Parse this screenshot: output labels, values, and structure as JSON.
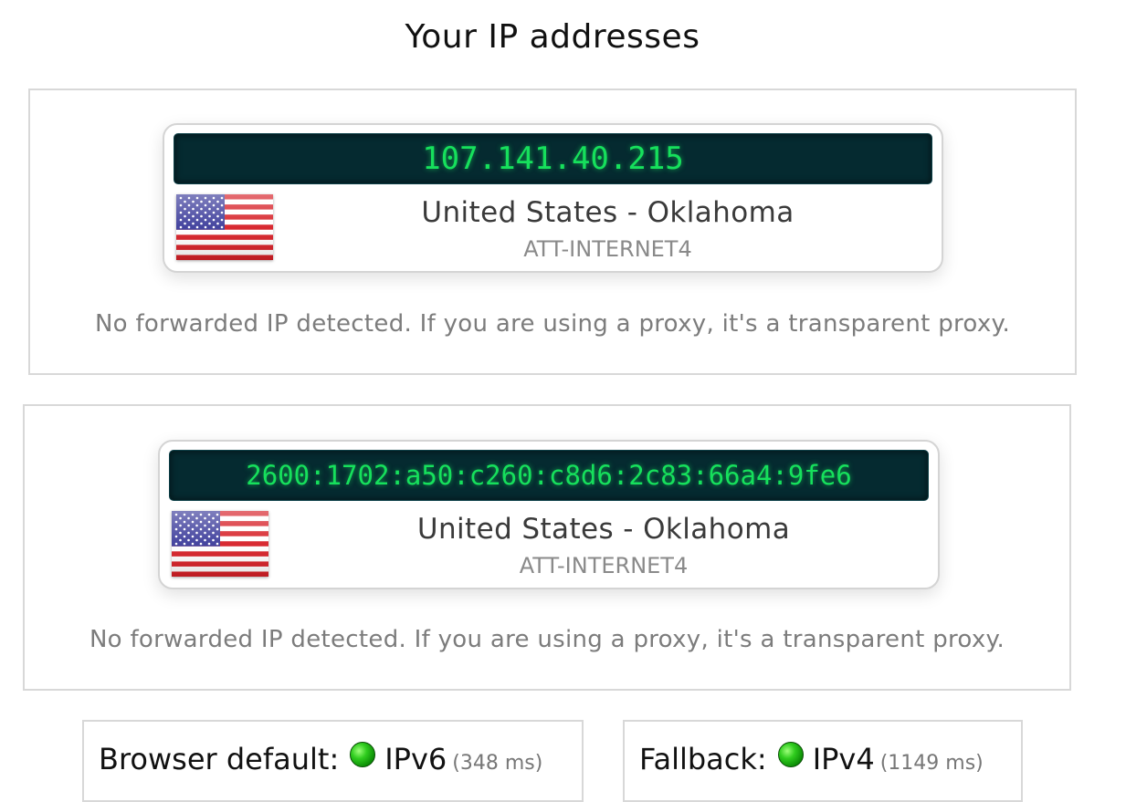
{
  "page": {
    "title": "Your IP addresses"
  },
  "ip_entries": [
    {
      "address": "107.141.40.215",
      "location": "United States - Oklahoma",
      "isp": "ATT-INTERNET4",
      "flag_icon": "us-flag-icon",
      "proxy_note": "No forwarded IP detected. If you are using a proxy, it's a transparent proxy."
    },
    {
      "address": "2600:1702:a50:c260:c8d6:2c83:66a4:9fe6",
      "location": "United States - Oklahoma",
      "isp": "ATT-INTERNET4",
      "flag_icon": "us-flag-icon",
      "proxy_note": "No forwarded IP detected. If you are using a proxy, it's a transparent proxy."
    }
  ],
  "status": {
    "browser_default": {
      "label": "Browser default:",
      "protocol": "IPv6",
      "latency": "(348 ms)",
      "indicator_color": "#22c414"
    },
    "fallback": {
      "label": "Fallback:",
      "protocol": "IPv4",
      "latency": "(1149 ms)",
      "indicator_color": "#22c414"
    }
  },
  "colors": {
    "display_bg": "#052a30",
    "display_text": "#16e05c"
  }
}
